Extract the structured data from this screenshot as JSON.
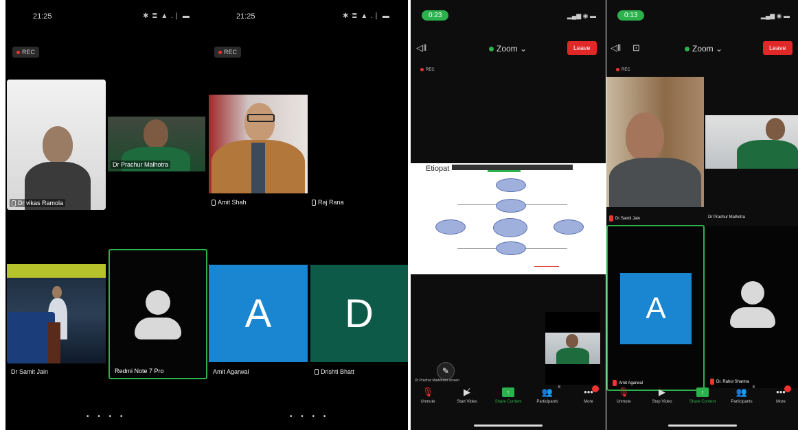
{
  "phone1": {
    "status_time": "21:25",
    "status_right": "✱ ≣ ▲ .❘ ▬",
    "rec": "REC",
    "tiles": [
      {
        "name": "Dr vikas Ramola"
      },
      {
        "name": "Dr Prachur Malhotra"
      },
      {
        "name": "Dr Samit Jain"
      },
      {
        "name": "Redmi Note 7 Pro"
      }
    ],
    "pager": "• • • •"
  },
  "phone2": {
    "status_time": "21:25",
    "status_right": "✱ ≣ ▲ .❘ ▬",
    "rec": "REC",
    "tiles": [
      {
        "name": "Amit Shah"
      },
      {
        "name": "Raj Rana"
      },
      {
        "name": "Amit Agarwal",
        "letter": "A"
      },
      {
        "name": "Drishti Bhatt",
        "letter": "D"
      }
    ],
    "pager": "• • • •"
  },
  "phone3": {
    "timer": "0:23",
    "title": "Zoom",
    "leave": "Leave",
    "rec": "REC",
    "share_caption": "Dr Prachur Malhotra's screen",
    "slide_title": "Etiopat",
    "toolbar": [
      {
        "label": "Unmute",
        "icon": "mic-off-icon"
      },
      {
        "label": "Start Video",
        "icon": "video-off-icon"
      },
      {
        "label": "Share Content",
        "icon": "share-icon"
      },
      {
        "label": "Participants",
        "icon": "participants-icon",
        "count": "8"
      },
      {
        "label": "More",
        "icon": "more-icon"
      }
    ]
  },
  "phone4": {
    "timer": "0:13",
    "title": "Zoom",
    "leave": "Leave",
    "rec": "REC",
    "tiles": [
      {
        "name": "Dr Samit Jain"
      },
      {
        "name": "Dr Prachur Malhotra"
      },
      {
        "name": "Amit Agarwal",
        "letter": "A"
      },
      {
        "name": "Dr. Rahul Sharma"
      }
    ],
    "toolbar": [
      {
        "label": "Unmute",
        "icon": "mic-off-icon"
      },
      {
        "label": "Stop Video",
        "icon": "video-icon"
      },
      {
        "label": "Share Content",
        "icon": "share-icon"
      },
      {
        "label": "Participants",
        "icon": "participants-icon",
        "count": "8"
      },
      {
        "label": "More",
        "icon": "more-icon"
      }
    ]
  },
  "colors": {
    "active_border": "#2bb24c",
    "leave": "#e02828",
    "avatar_blue": "#1a86d1",
    "avatar_green": "#0e5a48"
  }
}
